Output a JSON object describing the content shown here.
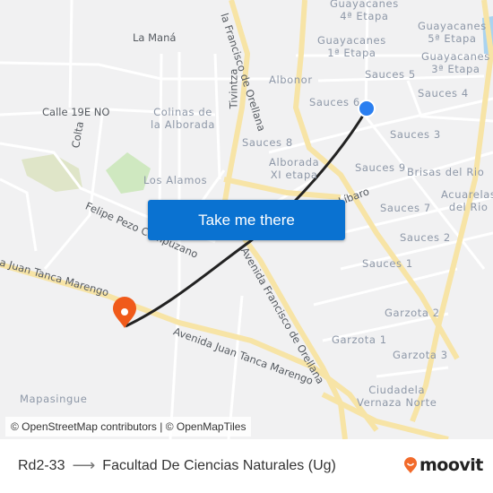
{
  "map": {
    "area_labels": [
      {
        "id": "guayacanes-4",
        "text": "Guayacanes\n4ª Etapa"
      },
      {
        "id": "guayacanes-5",
        "text": "Guayacanes\n5ª Etapa"
      },
      {
        "id": "guayacanes-1",
        "text": "Guayacanes\n1ª Etapa"
      },
      {
        "id": "guayacanes-3",
        "text": "Guayacanes\n3ª Etapa"
      },
      {
        "id": "la-mana",
        "text": "La Maná"
      },
      {
        "id": "albonor",
        "text": "Albonor"
      },
      {
        "id": "sauces-5",
        "text": "Sauces 5"
      },
      {
        "id": "sauces-4",
        "text": "Sauces 4"
      },
      {
        "id": "sauces-6",
        "text": "Sauces 6"
      },
      {
        "id": "sauces-3",
        "text": "Sauces 3"
      },
      {
        "id": "colinas",
        "text": "Colinas de\nla Alborada"
      },
      {
        "id": "sauces-8",
        "text": "Sauces 8"
      },
      {
        "id": "alborada-xi",
        "text": "Alborada\nXI etapa"
      },
      {
        "id": "sauces-9",
        "text": "Sauces 9"
      },
      {
        "id": "brisas",
        "text": "Brisas del Rio"
      },
      {
        "id": "acuarelas",
        "text": "Acuarelas\ndel Rio"
      },
      {
        "id": "los-alamos",
        "text": "Los Alamos"
      },
      {
        "id": "sauces-7",
        "text": "Sauces 7"
      },
      {
        "id": "sauces-2",
        "text": "Sauces 2"
      },
      {
        "id": "sauces-1",
        "text": "Sauces 1"
      },
      {
        "id": "garzota-2",
        "text": "Garzota 2"
      },
      {
        "id": "garzota-1",
        "text": "Garzota 1"
      },
      {
        "id": "garzota-3",
        "text": "Garzota 3"
      },
      {
        "id": "ciudadela",
        "text": "Ciudadela\nVernaza Norte"
      },
      {
        "id": "mapasingue",
        "text": "Mapasingue"
      }
    ],
    "street_labels": {
      "orellana_top": "la Francisco de Orellana",
      "tivintza": "Tivintza",
      "calle_19e": "Calle 19E NO",
      "colta": "Colta",
      "felipe_pezo": "Felipe Pezo Campuzano",
      "juan_tanca_left": "a Juan Tanca Marengo",
      "juan_tanca_right": "Avenida Juan Tanca Marengo",
      "orellana_bottom": "Avenida Francisco de Orellana",
      "libaro": "Líbaro"
    },
    "cta_label": "Take me there",
    "attribution": "© OpenStreetMap contributors | © OpenMapTiles",
    "colors": {
      "origin_marker": "#2b7ff0",
      "destination_marker": "#f05a1a",
      "route": "#222222",
      "major_road": "#f7e4a6",
      "cta": "#0a72d1"
    }
  },
  "footer": {
    "origin": "Rd2-33",
    "arrow": "⟶",
    "destination": "Facultad De Ciencias Naturales (Ug)",
    "brand": "moovit"
  }
}
